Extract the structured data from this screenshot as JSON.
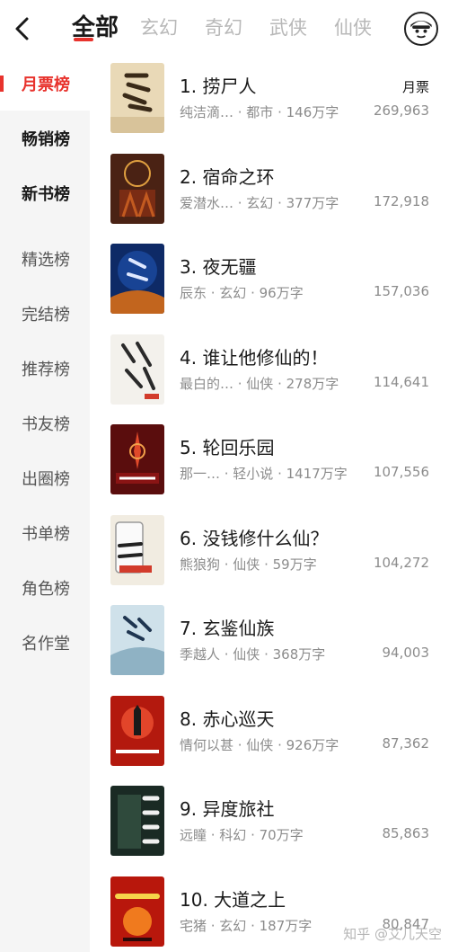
{
  "header": {
    "tabs": [
      {
        "label": "全部",
        "active": true
      },
      {
        "label": "玄幻",
        "active": false
      },
      {
        "label": "奇幻",
        "active": false
      },
      {
        "label": "武侠",
        "active": false
      },
      {
        "label": "仙侠",
        "active": false
      }
    ],
    "accent_color": "#e8332d"
  },
  "sidebar": {
    "items": [
      {
        "label": "月票榜",
        "active": true
      },
      {
        "label": "畅销榜"
      },
      {
        "label": "新书榜"
      },
      {
        "label": "精选榜"
      },
      {
        "label": "完结榜"
      },
      {
        "label": "推荐榜"
      },
      {
        "label": "书友榜"
      },
      {
        "label": "出圈榜"
      },
      {
        "label": "书单榜"
      },
      {
        "label": "角色榜"
      },
      {
        "label": "名作堂"
      }
    ]
  },
  "list": {
    "column_header": "月票",
    "books": [
      {
        "title": "1. 捞尸人",
        "meta": "纯洁滴… · 都市 · 146万字",
        "count": "269,963"
      },
      {
        "title": "2. 宿命之环",
        "meta": "爱潜水… · 玄幻 · 377万字",
        "count": "172,918"
      },
      {
        "title": "3. 夜无疆",
        "meta": "辰东 · 玄幻 · 96万字",
        "count": "157,036"
      },
      {
        "title": "4. 谁让他修仙的！",
        "meta": "最白的… · 仙侠 · 278万字",
        "count": "114,641"
      },
      {
        "title": "5. 轮回乐园",
        "meta": "那一… · 轻小说 · 1417万字",
        "count": "107,556"
      },
      {
        "title": "6. 没钱修什么仙？",
        "meta": "熊狼狗 · 仙侠 · 59万字",
        "count": "104,272"
      },
      {
        "title": "7. 玄鉴仙族",
        "meta": "季越人 · 仙侠 · 368万字",
        "count": "94,003"
      },
      {
        "title": "8. 赤心巡天",
        "meta": "情何以甚 · 仙侠 · 926万字",
        "count": "87,362"
      },
      {
        "title": "9. 异度旅社",
        "meta": "远瞳 · 科幻 · 70万字",
        "count": "85,863"
      },
      {
        "title": "10. 大道之上",
        "meta": "宅猪 · 玄幻 · 187万字",
        "count": "80,847"
      }
    ]
  },
  "watermark": "知乎 @艾儿天空"
}
